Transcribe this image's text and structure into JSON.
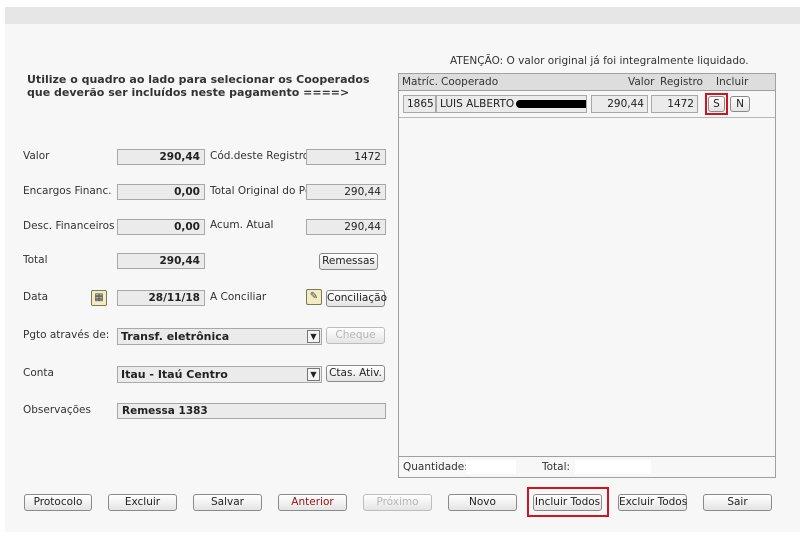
{
  "notice": "ATENÇÃO: O valor original já foi integralmente liquidado.",
  "instruction": "Utilize o quadro ao lado para selecionar os Cooperados que deverão ser incluídos neste pagamento  ====>",
  "form": {
    "valor_label": "Valor",
    "valor": "290,44",
    "encargos_label": "Encargos Financ.",
    "encargos": "0,00",
    "desc_label": "Desc. Financeiros",
    "desc": "0,00",
    "total_label": "Total",
    "total": "290,44",
    "data_label": "Data",
    "data": "28/11/18",
    "pgto_label": "Pgto através de:",
    "pgto": "Transf. eletrônica",
    "conta_label": "Conta",
    "conta": "Itau - Itaú Centro",
    "obs_label": "Observações",
    "obs": "Remessa 1383",
    "cod_label": "Cód.deste Registro",
    "cod": "1472",
    "total_orig_label": "Total Original do Pg",
    "total_orig": "290,44",
    "acum_label": "Acum. Atual",
    "acum": "290,44",
    "conciliar_label": "A Conciliar"
  },
  "buttons": {
    "remessas": "Remessas",
    "conciliacao": "Conciliação",
    "cheque": "Cheque",
    "ctas_ativ": "Ctas. Ativ.",
    "protocolo": "Protocolo",
    "excluir": "Excluir",
    "salvar": "Salvar",
    "anterior": "Anterior",
    "proximo": "Próximo",
    "novo": "Novo",
    "incluir_todos": "Incluir Todos",
    "excluir_todos": "Excluir Todos",
    "sair": "Sair"
  },
  "grid": {
    "headers": {
      "matric": "Matríc.",
      "cooperado": "Cooperado",
      "valor": "Valor",
      "registro": "Registro",
      "incluir": "Incluir"
    },
    "rows": [
      {
        "matric": "1865",
        "cooperado": "LUIS ALBERTO",
        "valor": "290,44",
        "registro": "1472",
        "sim": "S",
        "nao": "N"
      }
    ],
    "quantidade_label": "Quantidade:",
    "total_label": "Total:"
  },
  "colors": {
    "highlight": "#d0151d",
    "field_bg": "#ebebeb",
    "panel_bg": "#f7f7f7",
    "disabled_text": "#b5b5b5",
    "anterior_text": "#9a1010"
  }
}
